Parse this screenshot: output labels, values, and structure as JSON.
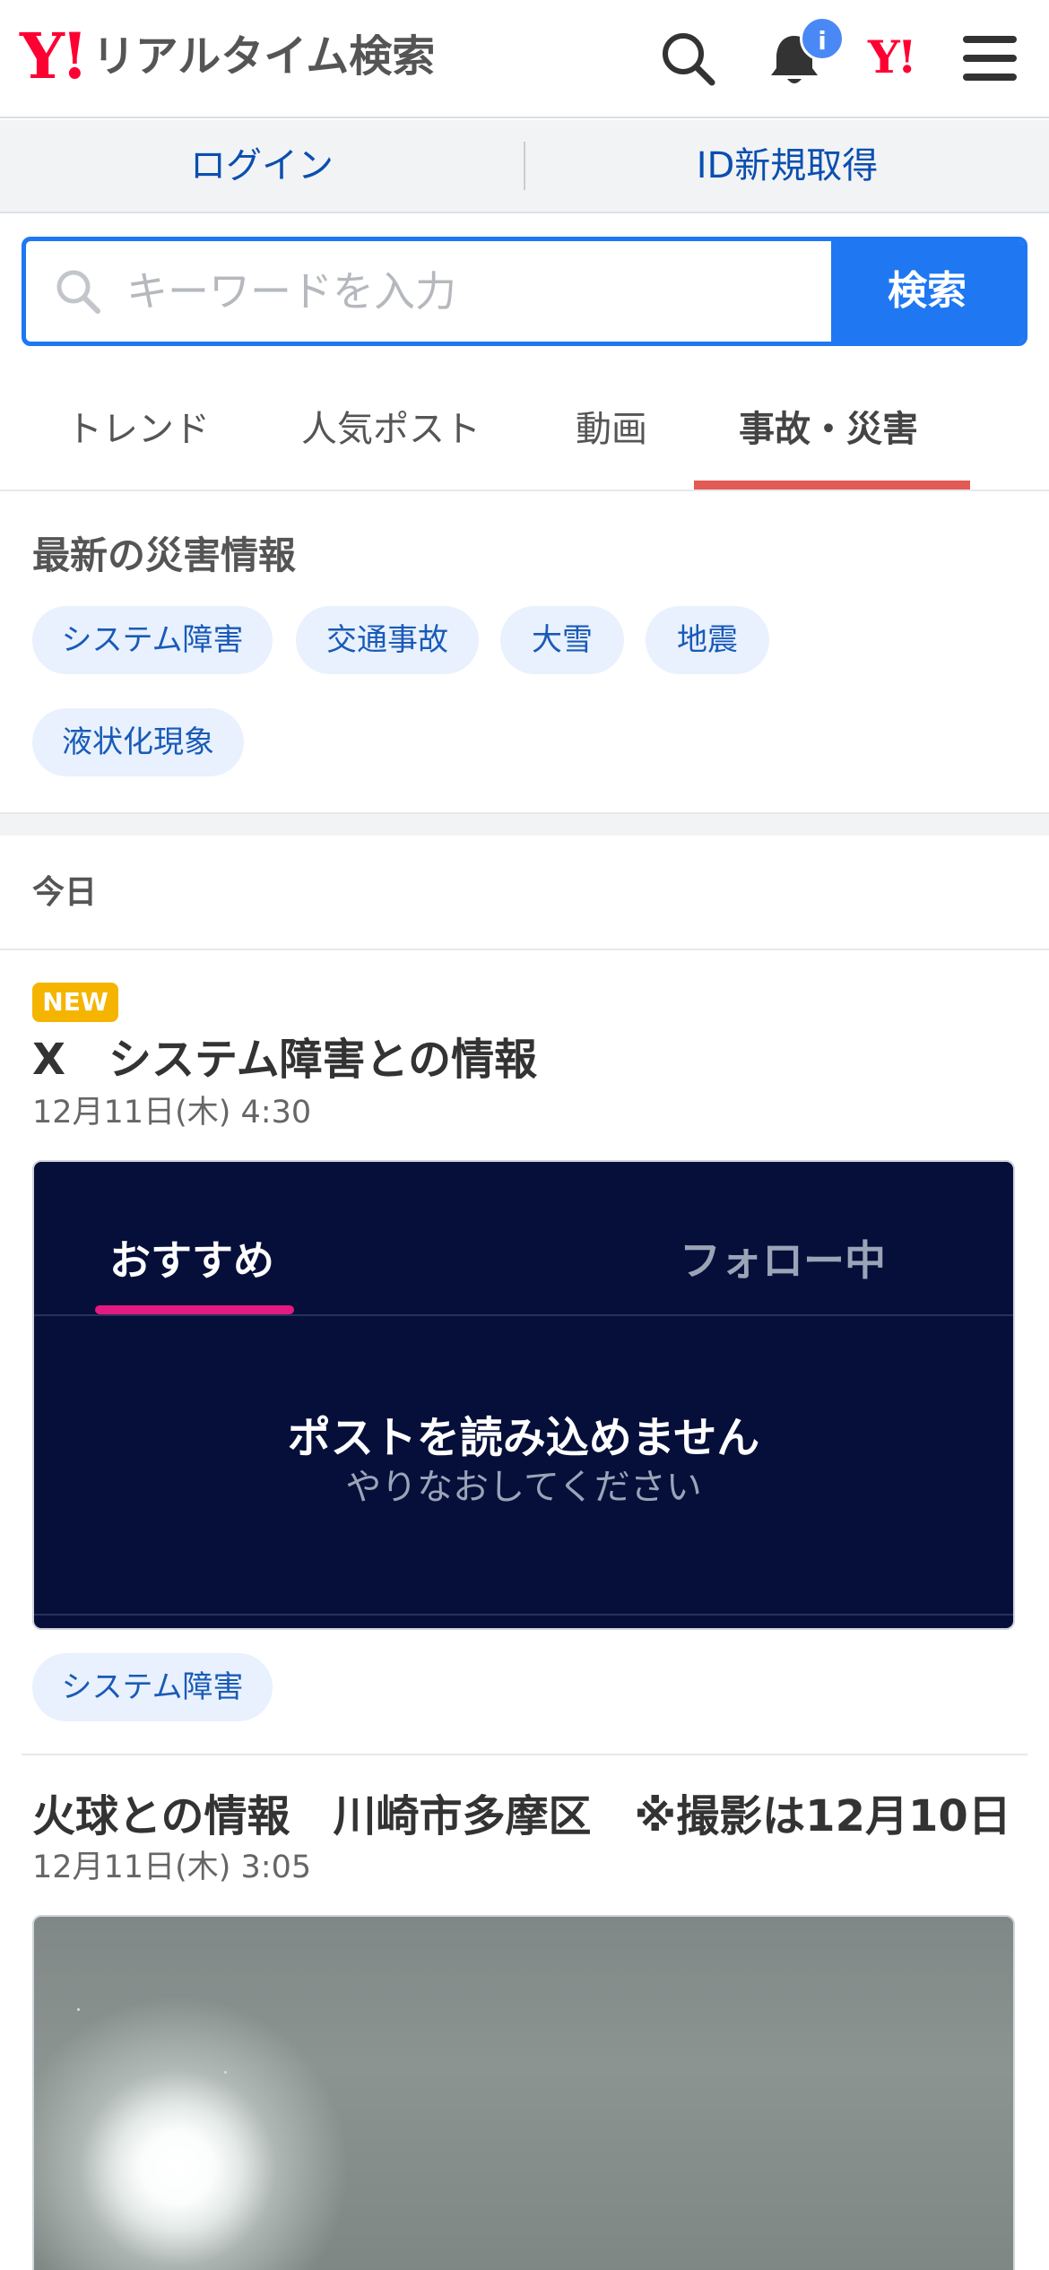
{
  "header": {
    "logo_mark": "Y!",
    "logo_text": "リアルタイム検索",
    "notification_badge": "i",
    "yjapan_mark": "Y!"
  },
  "account": {
    "login": "ログイン",
    "register": "ID新規取得"
  },
  "search": {
    "placeholder": "キーワードを入力",
    "button": "検索"
  },
  "tabs": [
    "トレンド",
    "人気ポスト",
    "動画",
    "事故・災害"
  ],
  "disaster": {
    "title": "最新の災害情報",
    "chips": [
      "システム障害",
      "交通事故",
      "大雪",
      "地震",
      "液状化現象"
    ]
  },
  "today_label": "今日",
  "articles": [
    {
      "badge": "NEW",
      "title": "X　システム障害との情報",
      "date": "12月11日(木) 4:30",
      "embed": {
        "tab_recommended": "おすすめ",
        "tab_following": "フォロー中",
        "message": "ポストを読み込めません",
        "sub_message": "やりなおしてください"
      },
      "tag": "システム障害"
    },
    {
      "title": "火球との情報　川崎市多摩区　※撮影は12月10日",
      "date": "12月11日(木) 3:05"
    }
  ],
  "colors": {
    "brand_red": "#ff0033",
    "accent_blue": "#1f77f2",
    "active_tab_underline": "#e35a55",
    "new_badge": "#f5b400",
    "x_card_bg": "#050f3a"
  }
}
